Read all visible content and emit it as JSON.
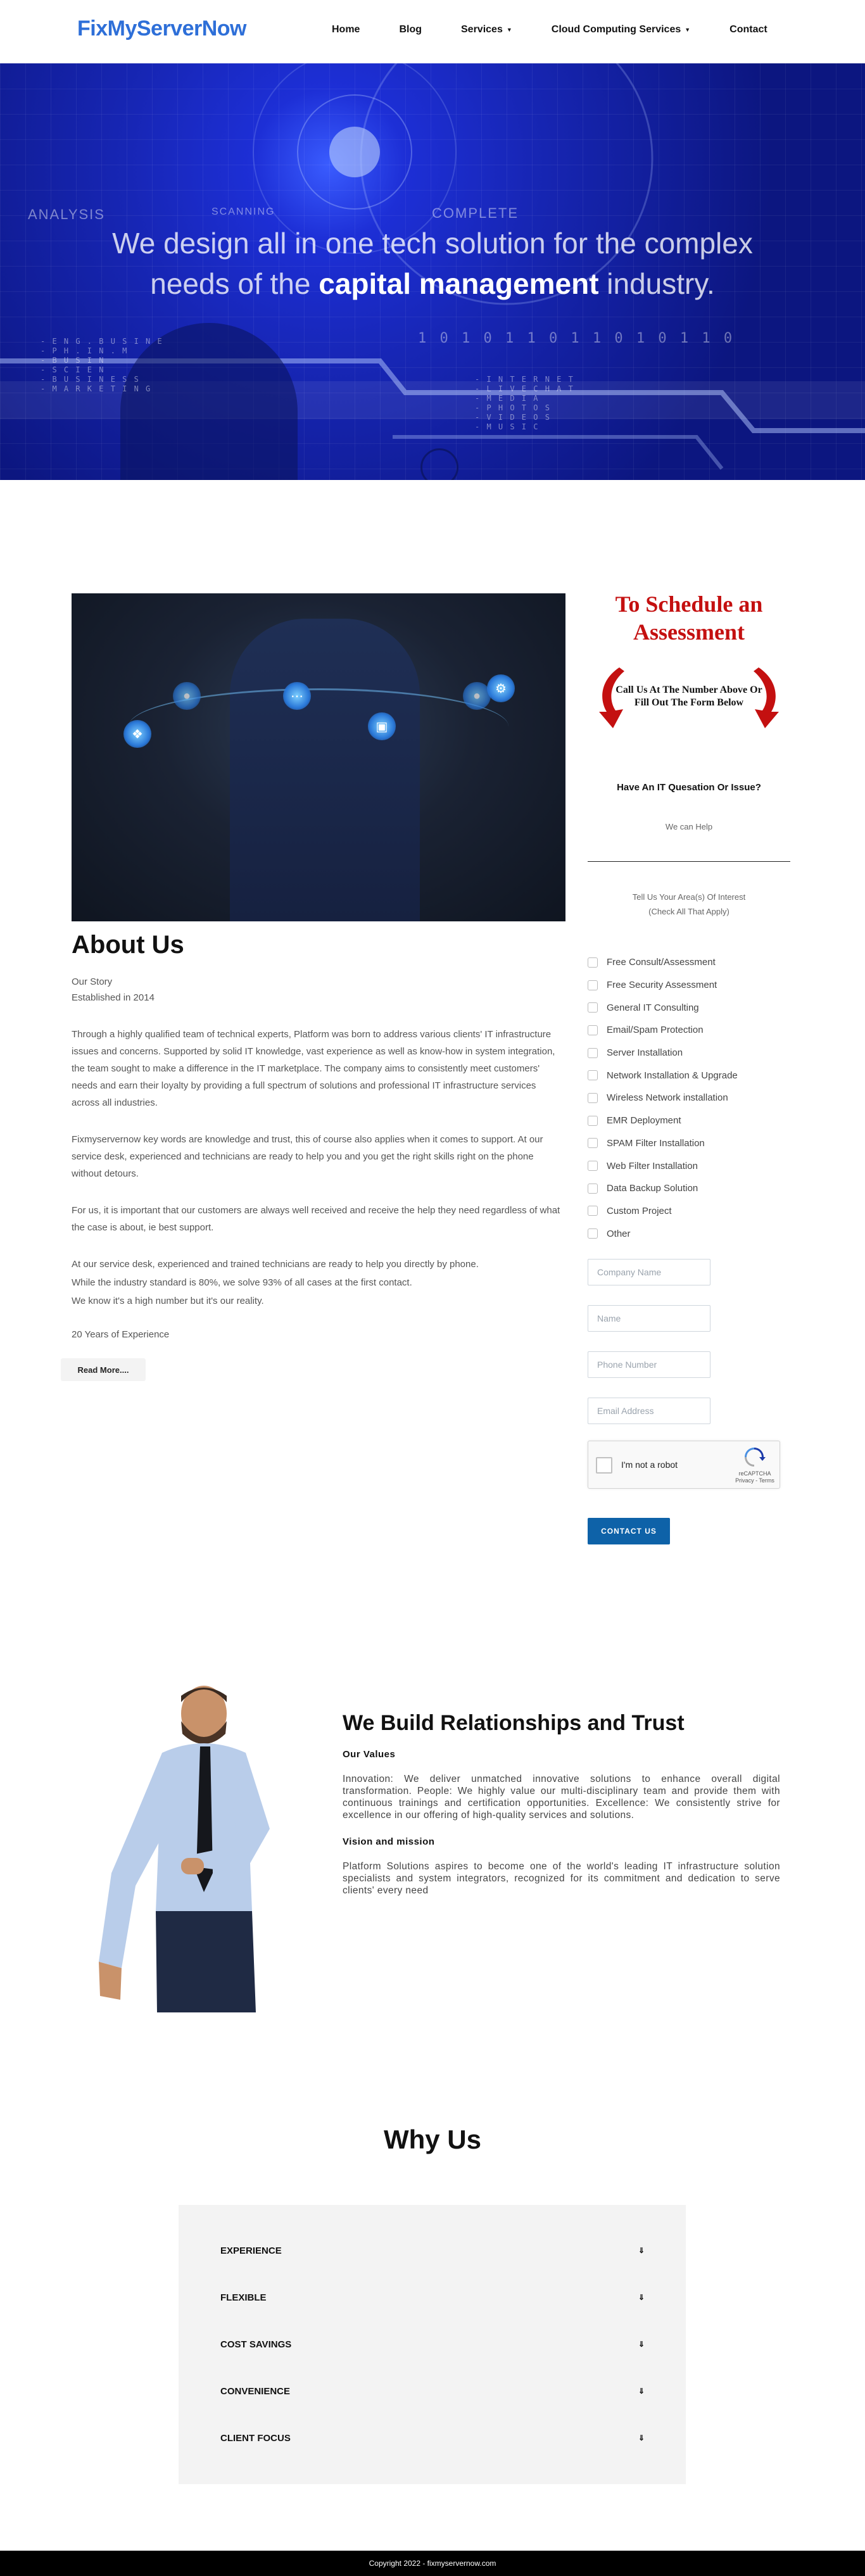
{
  "header": {
    "logo": "FixMyServerNow",
    "nav": [
      {
        "label": "Home"
      },
      {
        "label": "Blog"
      },
      {
        "label": "Services",
        "dropdown": true
      },
      {
        "label": "Cloud Computing Services",
        "dropdown": true
      },
      {
        "label": "Contact"
      }
    ]
  },
  "hero": {
    "line1": "We design all in one tech solution for the complex",
    "line2_pre": "needs of the ",
    "line2_bold": "capital management",
    "line2_post": " industry.",
    "overlay_labels": [
      "ANALYSIS",
      "SCANNING",
      "COMPLETE"
    ],
    "binary": "1 0 1 0 1 1 0 1 1 0 1 0 1 1 0",
    "list_left": [
      "- E N G . B U S I N E",
      "- P H . I N . M",
      "- B U S I N",
      "- S C I E N",
      "- B U S I N E S S",
      "- M A R K E T I N G"
    ],
    "list_right": [
      "- I N T E R N E T",
      "- L I V E C H A T",
      "- M E D I A",
      "- P H O T O S",
      "- V I D E O S",
      "- M U S I C"
    ]
  },
  "about": {
    "title": "About Us",
    "story": "Our Story",
    "established": "Established in 2014",
    "p1": "Through a highly qualified team of technical experts, Platform was born to address various clients' IT infrastructure issues and concerns. Supported by solid IT knowledge, vast experience as well as know-how in system integration, the team sought to make a difference in the IT marketplace. The company aims to consistently meet customers' needs and earn their loyalty by providing a full spectrum of solutions and professional IT infrastructure services across all industries.",
    "p2": "Fixmyservernow key words are knowledge and trust, this of course also applies when it comes to support. At our service desk, experienced and technicians are ready to help you and you get the right skills right on the phone without detours.",
    "p3": "For us, it is important that our customers are always well received and receive the help they need regardless of what the case is about, ie best support.",
    "p4a": "At our service desk, experienced and trained technicians are ready to help you directly by phone.",
    "p4b": "While the industry standard is 80%, we solve 93% of all cases at the first contact.",
    "p4c": "We know it's a high number but it's our reality.",
    "years": "20 Years of Experience",
    "read_more": "Read More....",
    "image_icons": [
      "puzzle-icon",
      "chat-icon",
      "lock-icon",
      "gear-icon"
    ]
  },
  "form": {
    "schedule_title": "To Schedule an Assessment",
    "schedule_sub": "Call Us At The Number Above Or Fill Out The Form Below",
    "question": "Have An IT Quesation Or Issue?",
    "can_help": "We can Help",
    "interest_line1": "Tell Us Your Area(s) Of Interest",
    "interest_line2": "(Check All That Apply)",
    "options": [
      "Free Consult/Assessment",
      "Free Security Assessment",
      "General IT Consulting",
      "Email/Spam Protection",
      "Server Installation",
      "Network Installation & Upgrade",
      "Wireless Network installation",
      "EMR Deployment",
      "SPAM Filter Installation",
      "Web Filter Installation",
      "Data Backup Solution",
      "Custom Project",
      "Other"
    ],
    "placeholders": {
      "company": "Company Name",
      "name": "Name",
      "phone": "Phone Number",
      "email": "Email Address"
    },
    "captcha_label": "I'm not a robot",
    "captcha_brand": "reCAPTCHA",
    "captcha_links": "Privacy - Terms",
    "submit": "CONTACT US",
    "accent": "#0e62a8",
    "title_color": "#c41010"
  },
  "relationships": {
    "title": "We Build Relationships and Trust",
    "values_heading": "Our Values",
    "values_text": "Innovation: We deliver unmatched innovative solutions to enhance overall digital transformation. People: We highly value our multi-disciplinary team and provide them with continuous trainings and certification opportunities. Excellence: We consistently strive for excellence in our offering of high-quality services and solutions.",
    "vision_heading": "Vision and mission",
    "vision_text": "Platform Solutions aspires to become one of the world's leading IT infrastructure solution specialists and system integrators, recognized for its commitment and dedication to serve clients' every need"
  },
  "why": {
    "title": "Why Us",
    "items": [
      "EXPERIENCE",
      "FLEXIBLE",
      "COST SAVINGS",
      "CONVENIENCE",
      "CLIENT FOCUS"
    ]
  },
  "footer": {
    "text": "Copyright 2022 - fixmyservernow.com"
  }
}
